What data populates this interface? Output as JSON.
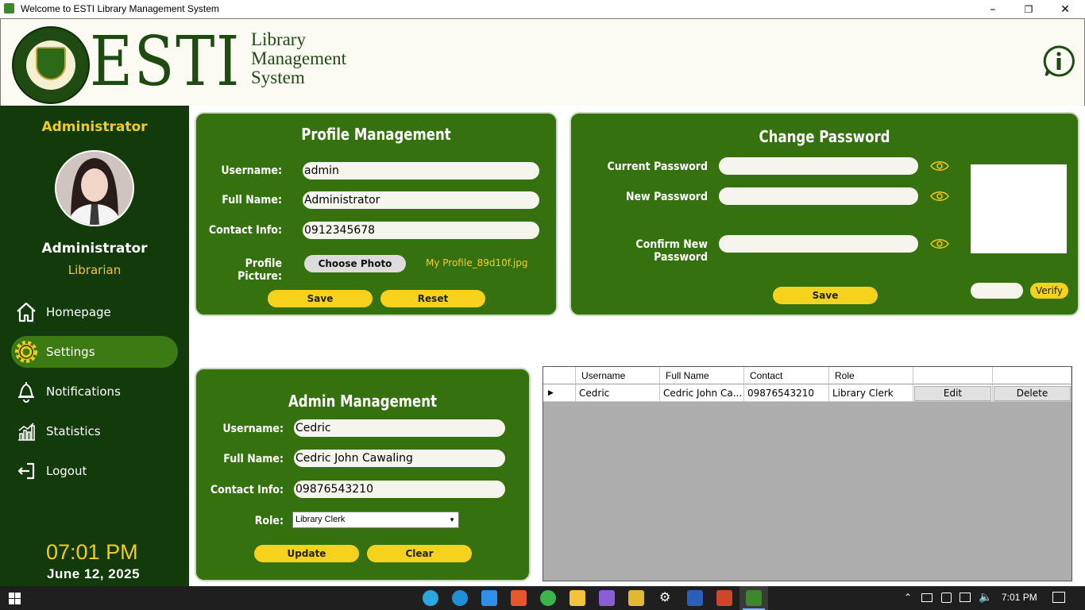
{
  "window": {
    "title": "Welcome to ESTI Library Management System",
    "minimize": "–",
    "maximize": "❐",
    "close": "✕"
  },
  "header": {
    "brand": "ESTI",
    "subtitle_lines": [
      "Library",
      "Management",
      "System"
    ]
  },
  "sidebar": {
    "role_top": "Administrator",
    "user_name": "Administrator",
    "user_role": "Librarian",
    "nav": [
      {
        "label": "Homepage",
        "icon": "home-icon"
      },
      {
        "label": "Settings",
        "icon": "gear-icon",
        "active": true
      },
      {
        "label": "Notifications",
        "icon": "bell-icon"
      },
      {
        "label": "Statistics",
        "icon": "chart-icon"
      },
      {
        "label": "Logout",
        "icon": "logout-icon"
      }
    ],
    "time": "07:01 PM",
    "date": "June 12, 2025"
  },
  "profile": {
    "title": "Profile Management",
    "username_label": "Username:",
    "username": "admin",
    "fullname_label": "Full Name:",
    "fullname": "Administrator",
    "contact_label": "Contact Info:",
    "contact": "0912345678",
    "picture_label": "Profile Picture:",
    "choose_photo": "Choose Photo",
    "photo_file": "My Profile_89d10f.jpg",
    "save": "Save",
    "reset": "Reset"
  },
  "password": {
    "title": "Change Password",
    "current_label": "Current Password",
    "new_label": "New Password",
    "confirm_label": "Confirm New Password",
    "save": "Save",
    "verify": "Verify"
  },
  "admin": {
    "title": "Admin Management",
    "username_label": "Username:",
    "username": "Cedric",
    "fullname_label": "Full Name:",
    "fullname": "Cedric John Cawaling",
    "contact_label": "Contact Info:",
    "contact": "09876543210",
    "role_label": "Role:",
    "role": "Library Clerk",
    "update": "Update",
    "clear": "Clear"
  },
  "grid": {
    "headers": [
      "Username",
      "Full Name",
      "Contact",
      "Role"
    ],
    "rows": [
      {
        "username": "Cedric",
        "fullname": "Cedric John Ca...",
        "contact": "09876543210",
        "role": "Library Clerk",
        "edit": "Edit",
        "delete": "Delete"
      }
    ]
  },
  "taskbar": {
    "time": "7:01 PM"
  },
  "colors": {
    "sidebar": "#123a0b",
    "panel": "#36710f",
    "accent": "#f7d21c",
    "brand": "#1f4a12"
  }
}
